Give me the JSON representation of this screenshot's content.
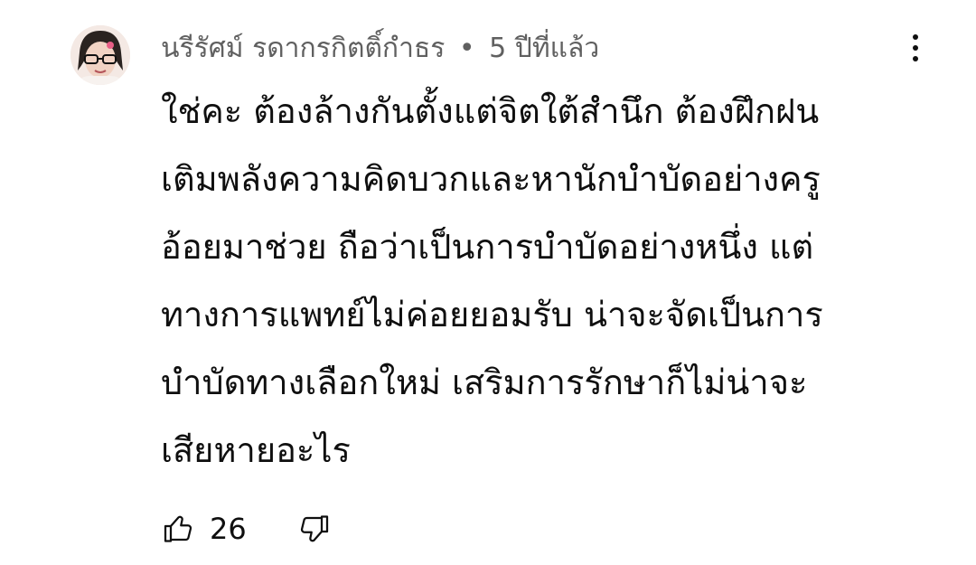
{
  "comment": {
    "author": "นรีรัศม์ รดากรกิตติ์กำธร",
    "separator": "•",
    "time": "5 ปีที่แล้ว",
    "lines": [
      "ใช่คะ ต้องล้างกันตั้งแต่จิตใต้สำนึก ต้องฝึกฝน",
      "เติมพลังความคิดบวกและหานักบำบัดอย่างครู",
      "อ้อยมาช่วย ถือว่าเป็นการบำบัดอย่างหนึ่ง แต่",
      "ทางการแพทย์ไม่ค่อยยอมรับ น่าจะจัดเป็นการ",
      "บำบัดทางเลือกใหม่ เสริมการรักษาก็ไม่น่าจะ",
      "เสียหายอะไร"
    ],
    "like_count": "26"
  },
  "icons": {
    "avatar": "avatar-image",
    "menu": "more-vert-icon",
    "like": "thumb-up-icon",
    "dislike": "thumb-down-icon"
  },
  "colors": {
    "meta_text": "#606060",
    "body_text": "#0f0f0f",
    "background": "#ffffff"
  }
}
